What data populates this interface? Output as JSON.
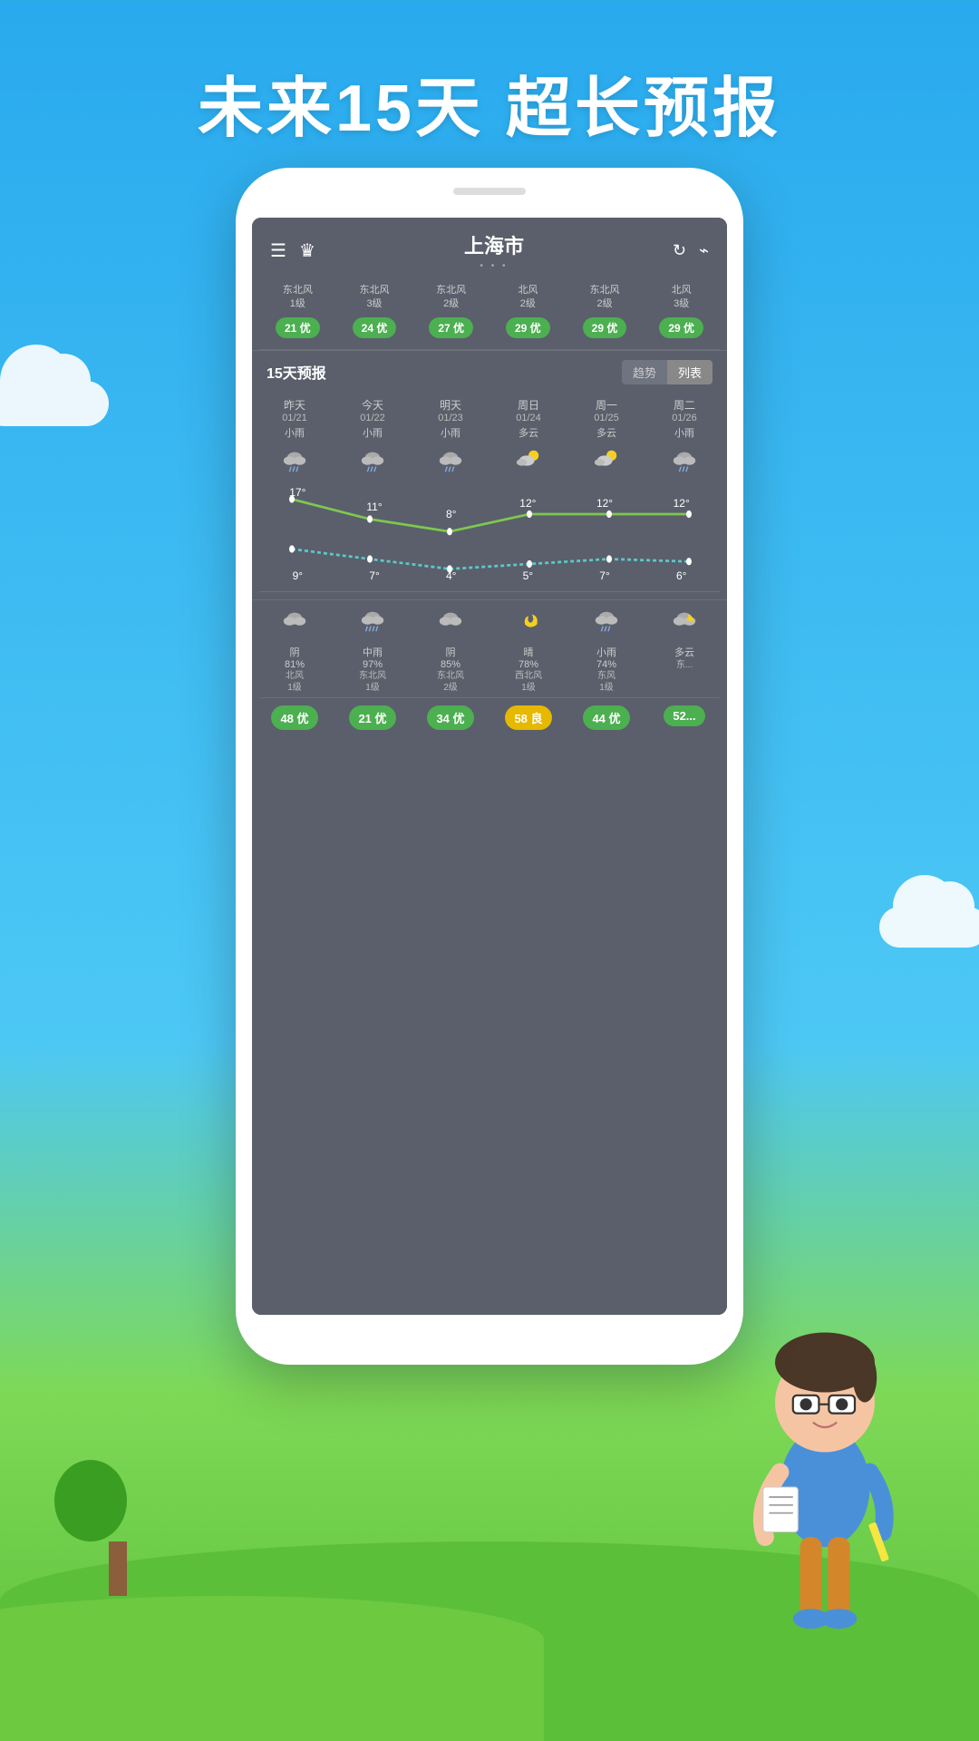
{
  "page": {
    "title": "未来15天  超长预报",
    "bg_top": "#29AAEE",
    "bg_bottom": "#5BBF3A"
  },
  "header": {
    "city": "上海市",
    "dots": "• • •",
    "menu_icon": "☰",
    "crown_icon": "♛",
    "refresh_icon": "↻",
    "share_icon": "⌁"
  },
  "aqi_row": {
    "columns": [
      {
        "wind": "东北风\n1级",
        "badge": "21 优",
        "type": "you"
      },
      {
        "wind": "东北风\n3级",
        "badge": "24 优",
        "type": "you"
      },
      {
        "wind": "东北风\n2级",
        "badge": "27 优",
        "type": "you"
      },
      {
        "wind": "北风\n2级",
        "badge": "29 优",
        "type": "you"
      },
      {
        "wind": "东北风\n2级",
        "badge": "29 优",
        "type": "you"
      },
      {
        "wind": "北风\n3级",
        "badge": "29 优",
        "type": "you"
      }
    ]
  },
  "section": {
    "title": "15天预报",
    "btn_trend": "趋势",
    "btn_list": "列表"
  },
  "forecast": {
    "days": [
      {
        "day": "昨天",
        "date": "01/21",
        "cond": "小雨",
        "icon": "🌧",
        "high": "17°",
        "low": "9°"
      },
      {
        "day": "今天",
        "date": "01/22",
        "cond": "小雨",
        "icon": "🌧",
        "high": "11°",
        "low": "7°"
      },
      {
        "day": "明天",
        "date": "01/23",
        "cond": "小雨",
        "icon": "🌧",
        "high": "8°",
        "low": "4°"
      },
      {
        "day": "周日",
        "date": "01/24",
        "cond": "多云",
        "icon": "⛅",
        "high": "12°",
        "low": "5°"
      },
      {
        "day": "周一",
        "date": "01/25",
        "cond": "多云",
        "icon": "⛅",
        "high": "12°",
        "low": "7°"
      },
      {
        "day": "周二",
        "date": "01/26",
        "cond": "小雨",
        "icon": "🌧",
        "high": "12°",
        "low": "6°"
      }
    ]
  },
  "night_forecast": {
    "columns": [
      {
        "icon": "☁",
        "cond": "阴",
        "pct": "81%",
        "wind": "北风\n1级"
      },
      {
        "icon": "🌧",
        "cond": "中雨",
        "pct": "97%",
        "wind": "东北风\n1级"
      },
      {
        "icon": "☁",
        "cond": "阴",
        "pct": "85%",
        "wind": "东北风\n2级"
      },
      {
        "icon": "🌙",
        "cond": "晴",
        "pct": "78%",
        "wind": "西北风\n1级"
      },
      {
        "icon": "🌨",
        "cond": "小雨",
        "pct": "74%",
        "wind": "东风\n1级"
      },
      {
        "icon": "☁",
        "cond": "多云",
        "pct": "",
        "wind": "东..."
      }
    ]
  },
  "bottom_aqi": {
    "columns": [
      {
        "badge": "48 优",
        "type": "you"
      },
      {
        "badge": "21 优",
        "type": "you"
      },
      {
        "badge": "34 优",
        "type": "you"
      },
      {
        "badge": "58 良",
        "type": "liang"
      },
      {
        "badge": "44 优",
        "type": "you"
      },
      {
        "badge": "52...",
        "type": "you"
      }
    ]
  }
}
